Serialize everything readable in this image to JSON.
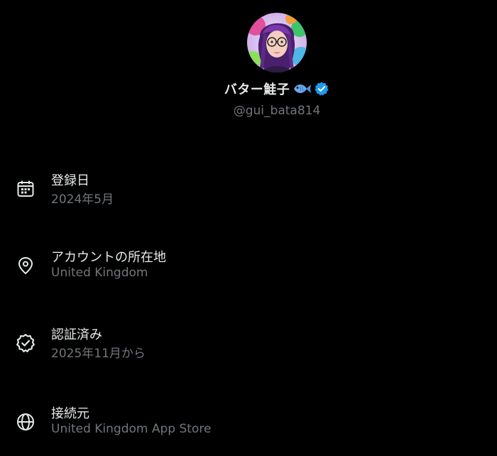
{
  "profile": {
    "display_name": "バター鮭子",
    "handle": "@gui_bata814",
    "avatar_icon": "avatar-illustration",
    "name_emoji_icon": "fish-icon",
    "verified_icon": "verified-badge-icon"
  },
  "about": {
    "items": [
      {
        "icon": "calendar-icon",
        "title": "登録日",
        "value": "2024年5月"
      },
      {
        "icon": "location-pin-icon",
        "title": "アカウントの所在地",
        "value": "United Kingdom"
      },
      {
        "icon": "verified-badge-outline-icon",
        "title": "認証済み",
        "value": "2025年11月から"
      },
      {
        "icon": "globe-icon",
        "title": "接続元",
        "value": "United Kingdom App Store"
      }
    ]
  },
  "colors": {
    "background": "#000000",
    "primary_text": "#e7e9ea",
    "secondary_text": "#71767b",
    "verified_blue": "#1d9bf0"
  }
}
